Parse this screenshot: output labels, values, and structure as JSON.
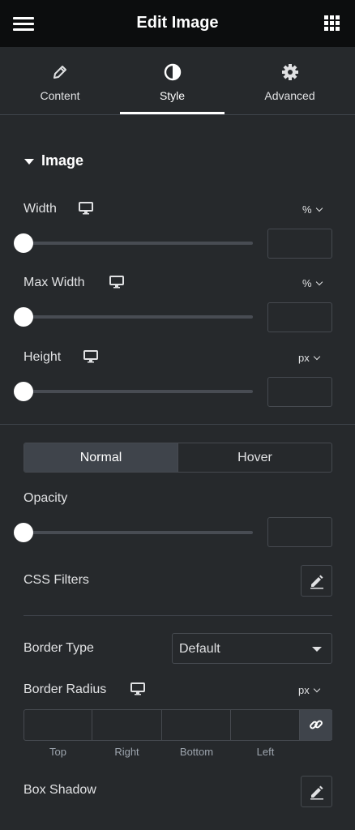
{
  "header": {
    "title": "Edit Image",
    "menu_icon": "hamburger-icon",
    "apps_icon": "grid-icon"
  },
  "tabs": [
    {
      "label": "Content",
      "icon": "pencil-icon"
    },
    {
      "label": "Style",
      "icon": "half-circle-icon",
      "active": true
    },
    {
      "label": "Advanced",
      "icon": "gear-icon"
    }
  ],
  "section": {
    "title": "Image",
    "expanded": true
  },
  "controls": {
    "width": {
      "label": "Width",
      "unit": "%",
      "value": "",
      "slider_position": 0
    },
    "max_width": {
      "label": "Max Width",
      "unit": "%",
      "value": "",
      "slider_position": 0
    },
    "height": {
      "label": "Height",
      "unit": "px",
      "value": "",
      "slider_position": 0
    },
    "state_tabs": {
      "normal": "Normal",
      "hover": "Hover",
      "selected": "Normal"
    },
    "opacity": {
      "label": "Opacity",
      "value": "",
      "slider_position": 0
    },
    "css_filters": {
      "label": "CSS Filters"
    },
    "border_type": {
      "label": "Border Type",
      "value": "Default"
    },
    "border_radius": {
      "label": "Border Radius",
      "unit": "px",
      "fields": {
        "top": "Top",
        "right": "Right",
        "bottom": "Bottom",
        "left": "Left"
      }
    },
    "box_shadow": {
      "label": "Box Shadow"
    }
  },
  "colors": {
    "background": "#26292c",
    "header": "#0c0d0e",
    "border": "#464a50",
    "active_fill": "#3f444b"
  }
}
